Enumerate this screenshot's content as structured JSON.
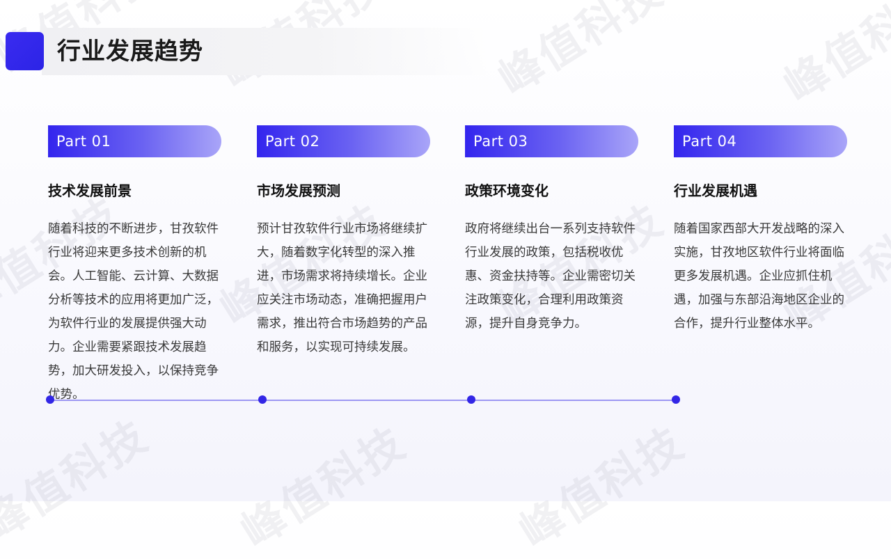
{
  "header": {
    "title": "行业发展趋势"
  },
  "watermark": {
    "text": "峰值科技"
  },
  "columns": [
    {
      "part_label": "Part 01",
      "title": "技术发展前景",
      "body": "随着科技的不断进步，甘孜软件行业将迎来更多技术创新的机会。人工智能、云计算、大数据分析等技术的应用将更加广泛，为软件行业的发展提供强大动力。企业需要紧跟技术发展趋势，加大研发投入，以保持竞争优势。"
    },
    {
      "part_label": "Part 02",
      "title": "市场发展预测",
      "body": "预计甘孜软件行业市场将继续扩大，随着数字化转型的深入推进，市场需求将持续增长。企业应关注市场动态，准确把握用户需求，推出符合市场趋势的产品和服务，以实现可持续发展。"
    },
    {
      "part_label": "Part 03",
      "title": "政策环境变化",
      "body": "政府将继续出台一系列支持软件行业发展的政策，包括税收优惠、资金扶持等。企业需密切关注政策变化，合理利用政策资源，提升自身竞争力。"
    },
    {
      "part_label": "Part 04",
      "title": "行业发展机遇",
      "body": "随着国家西部大开发战略的深入实施，甘孜地区软件行业将面临更多发展机遇。企业应抓住机遇，加强与东部沿海地区企业的合作，提升行业整体水平。"
    }
  ],
  "colors": {
    "accent": "#3226e6",
    "pill_start": "#3325ee",
    "pill_end": "#a9a5f8",
    "timeline": "#9c97f3"
  }
}
